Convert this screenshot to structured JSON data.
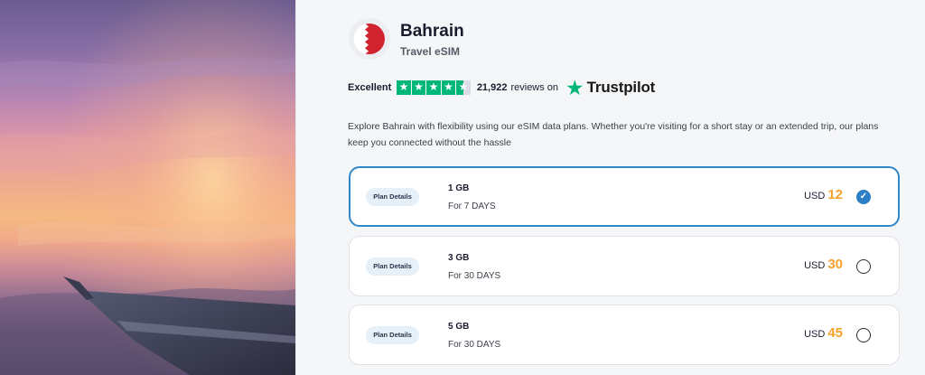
{
  "country": {
    "name": "Bahrain",
    "subtitle": "Travel eSIM",
    "flag_colors": {
      "red": "#d0222f",
      "white": "#ffffff"
    }
  },
  "rating": {
    "label": "Excellent",
    "stars": 4.5,
    "review_count": "21,922",
    "review_suffix": "reviews on",
    "provider": "Trustpilot",
    "star_color": "#00b67a"
  },
  "description": "Explore Bahrain with flexibility using our eSIM data plans. Whether you're visiting for a short stay or an extended trip, our plans keep you connected without the hassle",
  "plans": [
    {
      "details_label": "Plan Details",
      "data": "1 GB",
      "duration": "For 7 DAYS",
      "currency": "USD",
      "price": "12",
      "selected": true
    },
    {
      "details_label": "Plan Details",
      "data": "3 GB",
      "duration": "For 30 DAYS",
      "currency": "USD",
      "price": "30",
      "selected": false
    },
    {
      "details_label": "Plan Details",
      "data": "5 GB",
      "duration": "For 30 DAYS",
      "currency": "USD",
      "price": "45",
      "selected": false
    }
  ],
  "colors": {
    "accent": "#2e87c8",
    "price": "#f7a12b"
  }
}
